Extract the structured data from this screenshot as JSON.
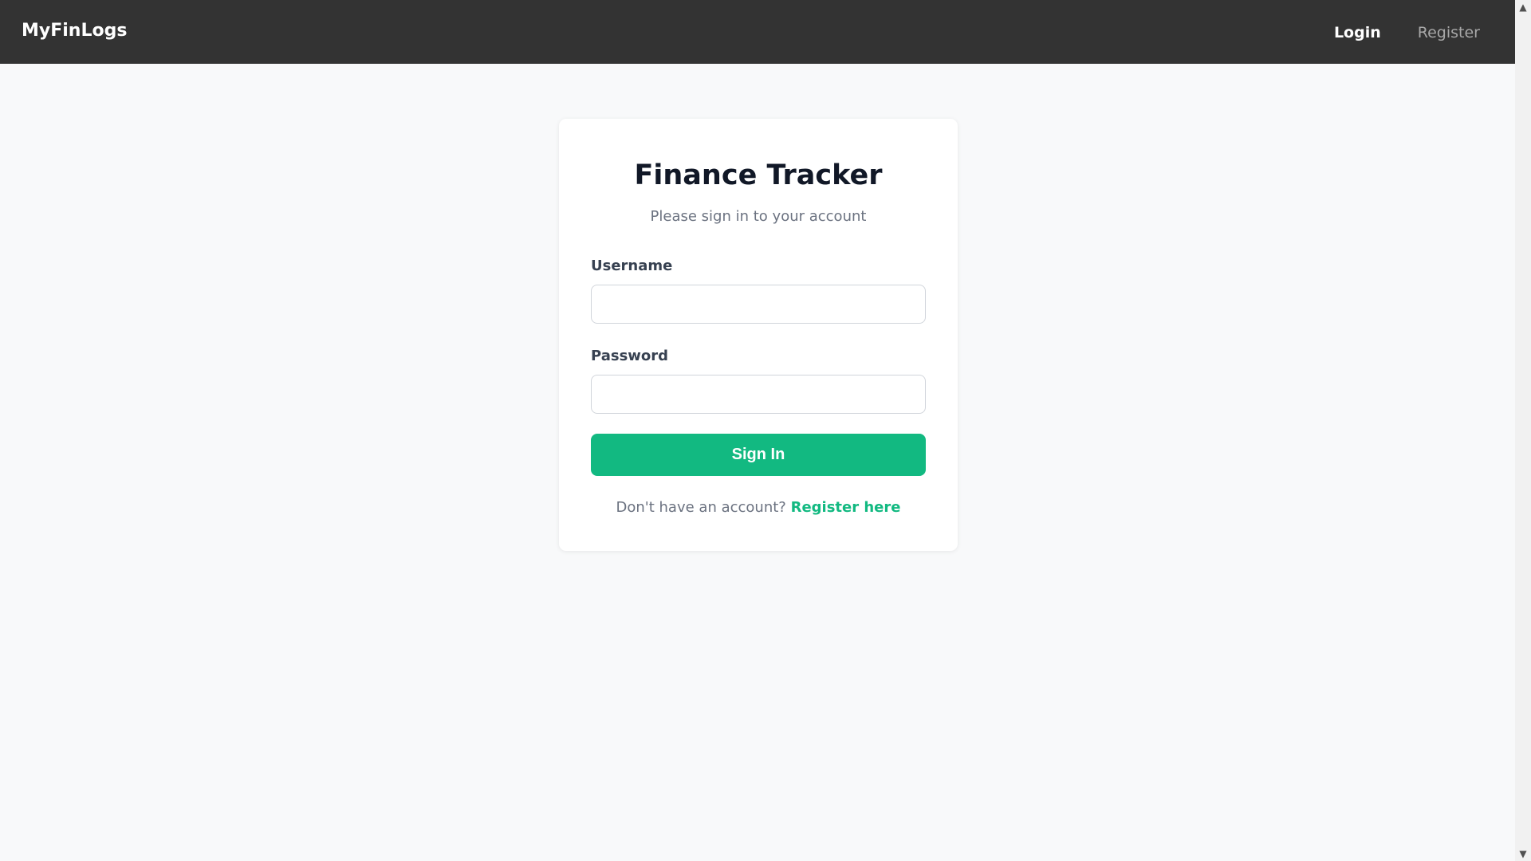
{
  "navbar": {
    "brand": "MyFinLogs",
    "links": [
      {
        "label": "Login",
        "active": true
      },
      {
        "label": "Register",
        "active": false
      }
    ]
  },
  "card": {
    "title": "Finance Tracker",
    "subtitle": "Please sign in to your account",
    "username": {
      "label": "Username",
      "value": "",
      "placeholder": ""
    },
    "password": {
      "label": "Password",
      "value": "",
      "placeholder": ""
    },
    "submit_label": "Sign In",
    "register_prompt": "Don't have an account?",
    "register_link": "Register here"
  },
  "colors": {
    "navbar_bg": "#333333",
    "page_bg": "#f8f9fa",
    "accent": "#12b981",
    "title": "#111827",
    "muted_text": "#6b7280"
  },
  "icons": {
    "scroll_up": "triangle-up-icon",
    "scroll_down": "triangle-down-icon"
  }
}
